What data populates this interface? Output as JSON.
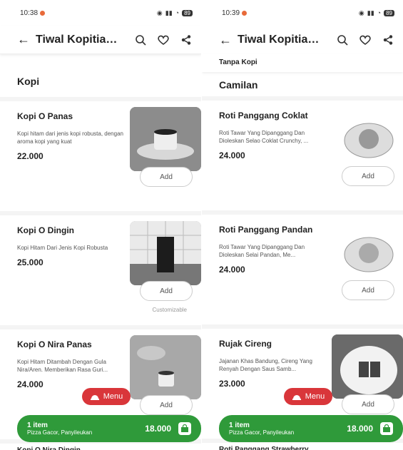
{
  "status": {
    "time_left": "10:38",
    "time_right": "10:39",
    "battery": "89"
  },
  "appbar": {
    "title": "Tiwal Kopitiam J..."
  },
  "left": {
    "section": "Kopi",
    "items": [
      {
        "name": "Kopi O Panas",
        "desc": "Kopi hitam dari jenis kopi robusta, dengan aroma kopi yang  kuat",
        "price": "22.000",
        "add": "Add"
      },
      {
        "name": "Kopi O Dingin",
        "desc": "Kopi Hitam Dari Jenis Kopi Robusta",
        "price": "25.000",
        "add": "Add",
        "note": "Customizable"
      },
      {
        "name": "Kopi O Nira Panas",
        "desc": "Kopi Hitam Ditambah Dengan Gula Nira/Aren. Memberikan Rasa Guri...",
        "price": "24.000",
        "add": "Add"
      }
    ]
  },
  "right": {
    "sticky_tab": "Tanpa Kopi",
    "section": "Camilan",
    "items": [
      {
        "name": "Roti Panggang Coklat",
        "desc": "Roti Tawar Yang Dipanggang Dan Dioleskan Selao Coklat Crunchy, ...",
        "price": "24.000",
        "add": "Add"
      },
      {
        "name": "Roti Panggang Pandan",
        "desc": "Roti Tawar Yang Dipanggang Dan Dioleskan Selai Pandan, Me...",
        "price": "24.000",
        "add": "Add"
      },
      {
        "name": "Rujak Cireng",
        "desc": "Jajanan Khas Bandung, Cireng Yang Renyah Dengan Saus Samb...",
        "price": "23.000",
        "add": "Add"
      }
    ]
  },
  "menu_label": "Menu",
  "cart": {
    "count": "1 item",
    "store": "Pizza Gacor, Panyileukan",
    "total": "18.000"
  },
  "peek": {
    "left": "Kopi O Nira Dingin",
    "right": "Roti Panggang Strawberry"
  },
  "colors": {
    "menu": "#d9363a",
    "cart": "#2f9a3a"
  }
}
